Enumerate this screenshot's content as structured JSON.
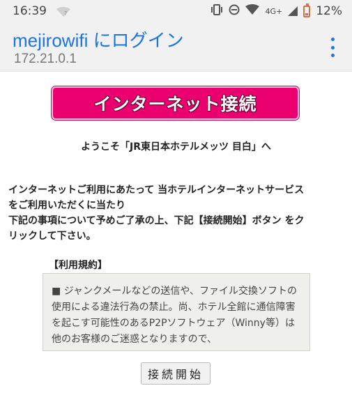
{
  "status_bar": {
    "time": "16:39",
    "network": "4G+",
    "battery": "12%"
  },
  "header": {
    "title": "mejirowifi にログイン",
    "subtitle": "172.21.0.1"
  },
  "page": {
    "banner_label": "インターネット接続",
    "welcome": "ようこそ「JR東日本ホテルメッツ 目白」へ",
    "intro_lines": [
      "インターネットご利用にあたって 当ホテルインターネットサービス",
      "をご利用いただくに当たり",
      "下記の事項について予めご了承の上、下記【接続開始】ボタン をク",
      "リックして下さい。"
    ],
    "terms_heading": "【利用規約】",
    "terms_text": "■ ジャンクメールなどの送信や、ファイル交換ソフトの使用による違法行為の禁止。尚、ホテル全館に通信障害を起こす可能性のあるP2Pソフトウェア（Winny等）は他のお客様のご迷惑となりますので、",
    "start_button": "接続開始"
  },
  "colors": {
    "accent": "#1a73e8",
    "banner": "#ea006e",
    "battery_low": "#e06a4c"
  }
}
